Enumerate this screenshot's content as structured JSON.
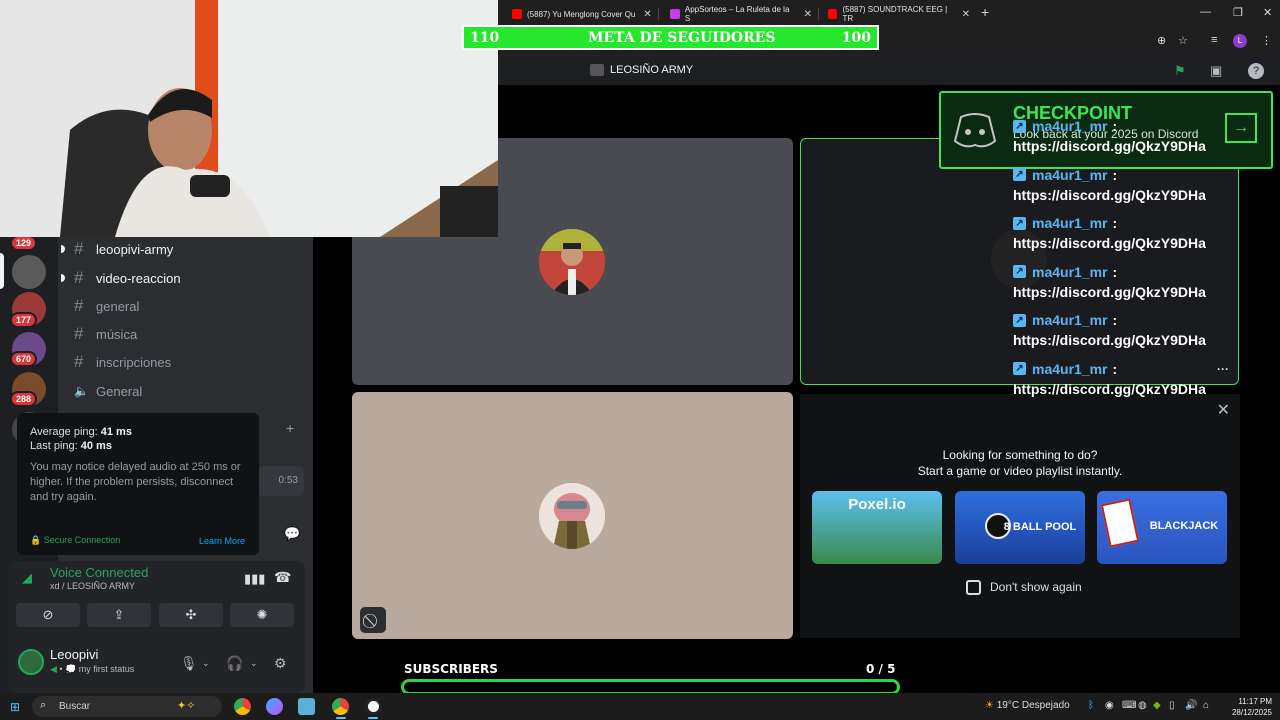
{
  "browser": {
    "tabs": [
      {
        "title": "(5887) Yu Menglong Cover Qu",
        "color": "#ff0000"
      },
      {
        "title": "AppSorteos – La Ruleta de la S",
        "color": "#c93de6"
      },
      {
        "title": "(5887) SOUNDTRACK EEG | TR",
        "color": "#ff0000"
      }
    ],
    "new_tab": "+",
    "minimize": "—",
    "restore": "❐",
    "close": "✕",
    "tab_close": "✕",
    "zoom_icon": "⊕",
    "star_icon": "☆",
    "media_icon": "≡",
    "profile_initial": "L",
    "menu_icon": "⋮"
  },
  "overlay": {
    "meta_left": "110",
    "meta_title": "META DE SEGUIDORES",
    "meta_right": "100",
    "subs_label": "SUBSCRIBERS",
    "subs_count": "0  / 5",
    "subs_progress": 0
  },
  "discord": {
    "server_name": "LEOSIÑO ARMY",
    "channels": [
      {
        "name": "leoopivi-army",
        "icon": "#",
        "state": "unread"
      },
      {
        "name": "video-reaccion",
        "icon": "#",
        "state": "unread"
      },
      {
        "name": "general",
        "icon": "#",
        "state": "read"
      },
      {
        "name": "música",
        "icon": "#",
        "state": "read"
      },
      {
        "name": "inscripciones",
        "icon": "#",
        "state": "read"
      },
      {
        "name": "General",
        "icon": "🔈",
        "state": "read"
      }
    ],
    "guild_badges": [
      "129",
      "177",
      "670",
      "288"
    ],
    "add_icon": "+",
    "timer": "0:53",
    "tooltip": {
      "avg_label": "Average ping:",
      "avg_value": "41 ms",
      "last_label": "Last ping:",
      "last_value": "40 ms",
      "warning": "You may notice delayed audio at 250 ms or higher. If the problem persists, disconnect and try again.",
      "secure": "Secure Connection",
      "learn_more": "Learn More"
    },
    "voice": {
      "status": "Voice Connected",
      "location": "xd / LEOSIÑO ARMY"
    },
    "user": {
      "name": "Leoopivi",
      "status": "my first status"
    },
    "activity": {
      "line1": "Looking for something to do?",
      "line2": "Start a game or video playlist instantly.",
      "games": [
        "Poxel.io",
        "8 BALL POOL",
        "BLACKJACK"
      ],
      "dont_show": "Don't show again",
      "close": "✕"
    },
    "checkpoint": {
      "title": "CHECKPOINT",
      "subtitle": "Look back at your 2025 on Discord",
      "arrow": "→"
    },
    "chat": [
      {
        "user": "ma4ur1_mr",
        "text": "https://discord.gg/QkzY9DHa"
      },
      {
        "user": "ma4ur1_mr",
        "text": "https://discord.gg/QkzY9DHa"
      },
      {
        "user": "ma4ur1_mr",
        "text": "https://discord.gg/QkzY9DHa"
      },
      {
        "user": "ma4ur1_mr",
        "text": "https://discord.gg/QkzY9DHa"
      },
      {
        "user": "ma4ur1_mr",
        "text": "https://discord.gg/QkzY9DHa"
      },
      {
        "user": "ma4ur1_mr",
        "text": "https://discord.gg/QkzY9DHa"
      }
    ],
    "more_icon": "···"
  },
  "taskbar": {
    "search": "Buscar",
    "weather_temp": "19°C",
    "weather_text": "Despejado",
    "time": "11:17 PM",
    "date": "28/12/2025"
  },
  "colors": {
    "accent_green": "#3ce65a",
    "discord_bg": "#2b2d31",
    "voice_green": "#23a55a",
    "link_blue": "#59b6f0"
  }
}
